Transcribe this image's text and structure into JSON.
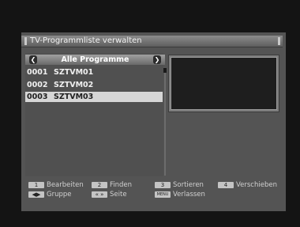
{
  "window": {
    "title": "TV-Programmliste verwalten"
  },
  "group": {
    "prev_icon": "chevron-left-icon",
    "next_icon": "chevron-right-icon",
    "label": "Alle Programme"
  },
  "channels": [
    {
      "number": "0001",
      "name": "SZTVM01",
      "selected": false
    },
    {
      "number": "0002",
      "name": "SZTVM02",
      "selected": false
    },
    {
      "number": "0003",
      "name": "SZTVM03",
      "selected": true
    }
  ],
  "help": {
    "edit": {
      "key": "1",
      "label": "Bearbeiten"
    },
    "find": {
      "key": "2",
      "label": "Finden"
    },
    "sort": {
      "key": "3",
      "label": "Sortieren"
    },
    "move": {
      "key": "4",
      "label": "Verschieben"
    },
    "group": {
      "key": "◀▶",
      "label": "Gruppe"
    },
    "page": {
      "key": "«  »",
      "label": "Seite"
    },
    "exit": {
      "key": "MENU",
      "label": "Verlassen"
    }
  },
  "colors": {
    "selection": "#d6d6d6",
    "background": "#545454"
  }
}
